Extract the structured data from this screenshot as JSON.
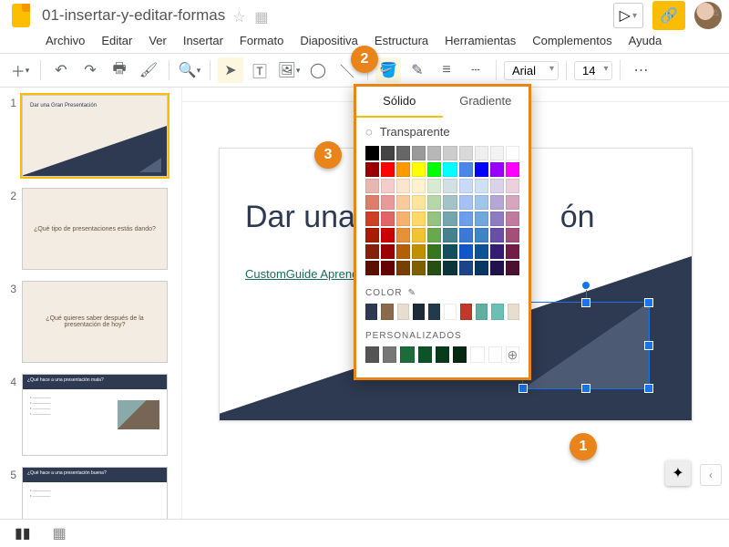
{
  "doc": {
    "name": "01-insertar-y-editar-formas"
  },
  "menus": [
    "Archivo",
    "Editar",
    "Ver",
    "Insertar",
    "Formato",
    "Diapositiva",
    "Estructura",
    "Herramientas",
    "Complementos",
    "Ayuda"
  ],
  "toolbar": {
    "font": "Arial",
    "fontsize": "14"
  },
  "slide": {
    "title": "Dar una Gran Presentación",
    "title_visible_partial": "Dar una G                    ón",
    "link_text": "CustomGuide Aprend"
  },
  "thumbnails": [
    {
      "idx": "1",
      "type": "title",
      "line1": "Dar una Gran Presentación"
    },
    {
      "idx": "2",
      "type": "center",
      "text": "¿Qué tipo de presentaciones estás dando?"
    },
    {
      "idx": "3",
      "type": "center",
      "text": "¿Qué quieres saber después de la presentación de hoy?"
    },
    {
      "idx": "4",
      "type": "darkbullets",
      "heading": "¿Qué hace a una presentación mala?"
    },
    {
      "idx": "5",
      "type": "darkbullets",
      "heading": "¿Qué hace a una presentación buena?"
    }
  ],
  "popup": {
    "tab_solid": "Sólido",
    "tab_gradient": "Gradiente",
    "transparent_label": "Transparente",
    "section_color": "COLOR",
    "section_custom": "PERSONALIZADOS",
    "rows_basic": [
      [
        "#000000",
        "#434343",
        "#666666",
        "#999999",
        "#b7b7b7",
        "#cccccc",
        "#d9d9d9",
        "#efefef",
        "#f3f3f3",
        "#ffffff"
      ],
      [
        "#980000",
        "#ff0000",
        "#ff9900",
        "#ffff00",
        "#00ff00",
        "#00ffff",
        "#4a86e8",
        "#0000ff",
        "#9900ff",
        "#ff00ff"
      ],
      [
        "#e6b8af",
        "#f4cccc",
        "#fce5cd",
        "#fff2cc",
        "#d9ead3",
        "#d0e0e3",
        "#c9daf8",
        "#cfe2f3",
        "#d9d2e9",
        "#ead1dc"
      ],
      [
        "#dd7e6b",
        "#ea9999",
        "#f9cb9c",
        "#ffe599",
        "#b6d7a8",
        "#a2c4c9",
        "#a4c2f4",
        "#9fc5e8",
        "#b4a7d6",
        "#d5a6bd"
      ],
      [
        "#cc4125",
        "#e06666",
        "#f6b26b",
        "#ffd966",
        "#93c47d",
        "#76a5af",
        "#6d9eeb",
        "#6fa8dc",
        "#8e7cc3",
        "#c27ba0"
      ],
      [
        "#a61c00",
        "#cc0000",
        "#e69138",
        "#f1c232",
        "#6aa84f",
        "#45818e",
        "#3c78d8",
        "#3d85c6",
        "#674ea7",
        "#a64d79"
      ],
      [
        "#85200c",
        "#990000",
        "#b45f06",
        "#bf9000",
        "#38761d",
        "#134f5c",
        "#1155cc",
        "#0b5394",
        "#351c75",
        "#741b47"
      ],
      [
        "#5b0f00",
        "#660000",
        "#783f04",
        "#7f6000",
        "#274e13",
        "#0c343d",
        "#1c4587",
        "#073763",
        "#20124d",
        "#4c1130"
      ]
    ],
    "theme_colors": [
      "#2e3a52",
      "#8a6a4a",
      "#e8ded0",
      "#1d2b3a",
      "#223a4a",
      "#ffffff",
      "#c0392b",
      "#5fb0a0",
      "#6ac0b5",
      "#e8ded0"
    ],
    "custom_colors": [
      "#555555",
      "#777777",
      "#1d6b3a",
      "#0c5427",
      "#083a1c",
      "#052a14",
      "#ffffff",
      "#ffffff"
    ]
  },
  "callouts": {
    "c1": "1",
    "c2": "2",
    "c3": "3"
  }
}
